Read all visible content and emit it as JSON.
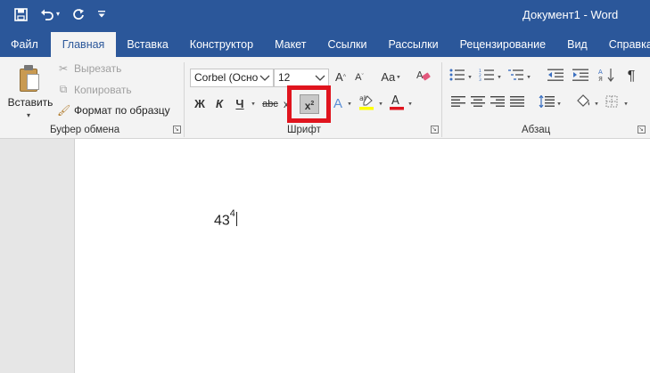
{
  "window": {
    "title": "Документ1 - Word"
  },
  "quick_access": {
    "save_icon": "save-icon",
    "undo_icon": "undo-icon",
    "redo_icon": "redo-icon",
    "customize_icon": "customize-qat-icon"
  },
  "tabs": [
    {
      "label": "Файл"
    },
    {
      "label": "Главная"
    },
    {
      "label": "Вставка"
    },
    {
      "label": "Конструктор"
    },
    {
      "label": "Макет"
    },
    {
      "label": "Ссылки"
    },
    {
      "label": "Рассылки"
    },
    {
      "label": "Рецензирование"
    },
    {
      "label": "Вид"
    },
    {
      "label": "Справка"
    }
  ],
  "active_tab": "Главная",
  "clipboard": {
    "paste_label": "Вставить",
    "cut_label": "Вырезать",
    "copy_label": "Копировать",
    "format_painter_label": "Формат по образцу",
    "group_label": "Буфер обмена"
  },
  "font": {
    "font_name": "Corbel (Осно",
    "font_size": "12",
    "bold": "Ж",
    "italic": "К",
    "underline": "Ч",
    "strikethrough": "abc",
    "subscript": "x",
    "superscript_base": "x",
    "superscript_exp": "2",
    "grow": "A",
    "shrink": "A",
    "change_case": "Aa",
    "font_color_letter": "A",
    "highlight_letters": "ab",
    "text_effects_letter": "A",
    "group_label": "Шрифт"
  },
  "paragraph": {
    "group_label": "Абзац",
    "pilcrow": "¶"
  },
  "document": {
    "base": "43",
    "exponent": "4"
  },
  "colors": {
    "accent": "#2b579a",
    "highlight_frame": "#e0141e",
    "font_color_bar": "#e0141e",
    "highlight_bar": "#ffff00"
  }
}
